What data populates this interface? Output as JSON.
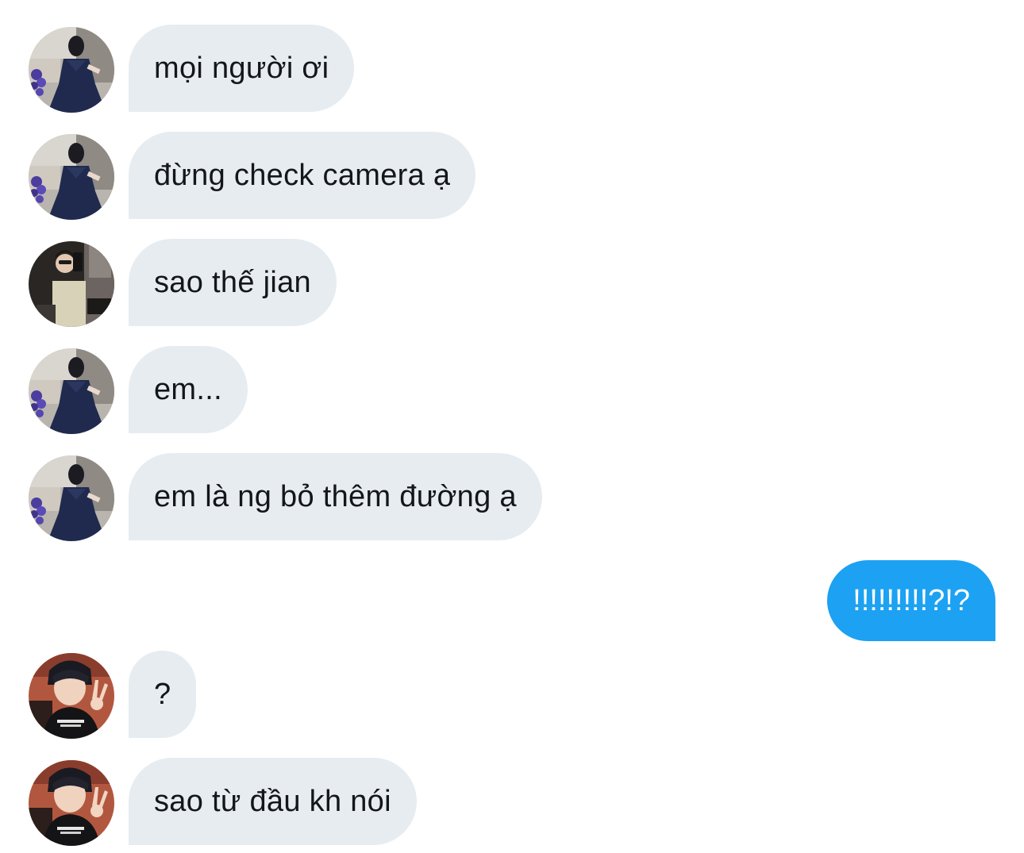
{
  "conversation": {
    "messages": [
      {
        "direction": "incoming",
        "avatar": "avatar-woman-navy-dress",
        "text": "mọi người ơi"
      },
      {
        "direction": "incoming",
        "avatar": "avatar-woman-navy-dress",
        "text": "đừng check camera ạ"
      },
      {
        "direction": "incoming",
        "avatar": "avatar-mirror-selfie",
        "text": "sao thế jian"
      },
      {
        "direction": "incoming",
        "avatar": "avatar-woman-navy-dress",
        "text": "em..."
      },
      {
        "direction": "incoming",
        "avatar": "avatar-woman-navy-dress",
        "text": "em là ng bỏ thêm đường ạ"
      },
      {
        "direction": "outgoing",
        "text": "!!!!!!!!!?!?"
      },
      {
        "direction": "incoming",
        "avatar": "avatar-boy-peace-sign",
        "text": "?"
      },
      {
        "direction": "incoming",
        "avatar": "avatar-boy-peace-sign",
        "text": "sao từ đầu kh nói"
      }
    ]
  },
  "colors": {
    "incoming_bubble": "#e6ecf0",
    "incoming_text": "#14171a",
    "outgoing_bubble": "#1da1f2",
    "outgoing_text": "#ffffff",
    "background": "#ffffff"
  }
}
